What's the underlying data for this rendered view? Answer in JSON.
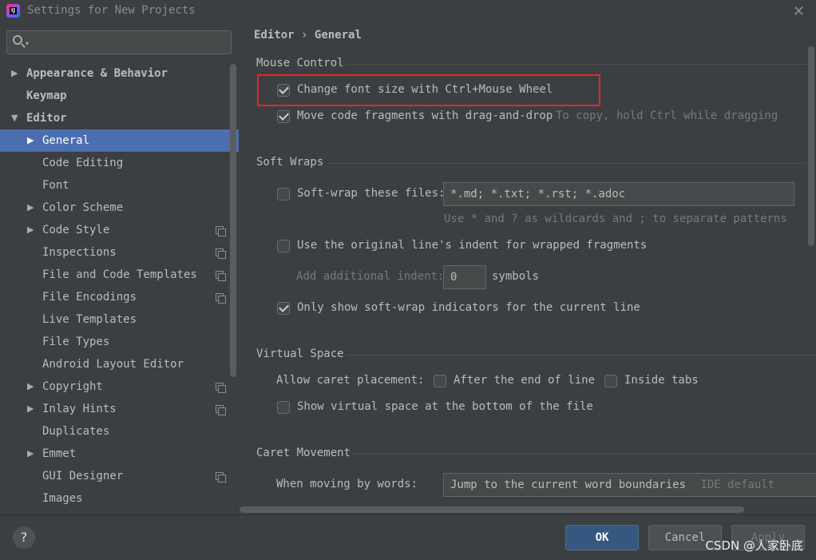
{
  "window": {
    "title": "Settings for New Projects",
    "close_symbol": "✕"
  },
  "search": {
    "placeholder": "",
    "dropdown_symbol": "▾"
  },
  "sidebar": {
    "items": [
      {
        "label": "Appearance & Behavior",
        "arrow": "▶"
      },
      {
        "label": "Keymap",
        "arrow": ""
      },
      {
        "label": "Editor",
        "arrow": "▼"
      },
      {
        "label": "General",
        "arrow": "▶"
      },
      {
        "label": "Code Editing",
        "arrow": ""
      },
      {
        "label": "Font",
        "arrow": ""
      },
      {
        "label": "Color Scheme",
        "arrow": "▶"
      },
      {
        "label": "Code Style",
        "arrow": "▶"
      },
      {
        "label": "Inspections",
        "arrow": ""
      },
      {
        "label": "File and Code Templates",
        "arrow": ""
      },
      {
        "label": "File Encodings",
        "arrow": ""
      },
      {
        "label": "Live Templates",
        "arrow": ""
      },
      {
        "label": "File Types",
        "arrow": ""
      },
      {
        "label": "Android Layout Editor",
        "arrow": ""
      },
      {
        "label": "Copyright",
        "arrow": "▶"
      },
      {
        "label": "Inlay Hints",
        "arrow": "▶"
      },
      {
        "label": "Duplicates",
        "arrow": ""
      },
      {
        "label": "Emmet",
        "arrow": "▶"
      },
      {
        "label": "GUI Designer",
        "arrow": ""
      },
      {
        "label": "Images",
        "arrow": ""
      }
    ]
  },
  "breadcrumb": {
    "parent": "Editor",
    "separator": "›",
    "current": "General"
  },
  "mouse_control": {
    "title": "Mouse Control",
    "change_font_size": {
      "label": "Change font size with Ctrl+Mouse Wheel",
      "checked": true
    },
    "move_code": {
      "label": "Move code fragments with drag-and-drop",
      "checked": true,
      "hint": "To copy, hold Ctrl while dragging"
    }
  },
  "soft_wraps": {
    "title": "Soft Wraps",
    "soft_wrap_files": {
      "label": "Soft-wrap these files:",
      "checked": false,
      "value": "*.md; *.txt; *.rst; *.adoc"
    },
    "patterns_hint": "Use * and ? as wildcards and ; to separate patterns",
    "original_indent": {
      "label": "Use the original line's indent for wrapped fragments",
      "checked": false
    },
    "additional_indent": {
      "label": "Add additional indent:",
      "value": "0",
      "unit": "symbols"
    },
    "indicators": {
      "label": "Only show soft-wrap indicators for the current line",
      "checked": true
    }
  },
  "virtual_space": {
    "title": "Virtual Space",
    "caret_placement_label": "Allow caret placement:",
    "after_end": {
      "label": "After the end of line",
      "checked": false
    },
    "inside_tabs": {
      "label": "Inside tabs",
      "checked": false
    },
    "show_virtual": {
      "label": "Show virtual space at the bottom of the file",
      "checked": false
    }
  },
  "caret_movement": {
    "title": "Caret Movement",
    "moving_by_words_label": "When moving by words:",
    "moving_by_words_value": "Jump to the current word boundaries",
    "moving_by_words_hint": "IDE default"
  },
  "footer": {
    "help_symbol": "?",
    "ok": "OK",
    "cancel": "Cancel",
    "apply": "Apply",
    "watermark": "CSDN @人家卧底"
  },
  "colors": {
    "selection": "#4b6eaf",
    "panel": "#3c3f41",
    "highlight_box": "#e5262a",
    "primary_button": "#365880"
  }
}
